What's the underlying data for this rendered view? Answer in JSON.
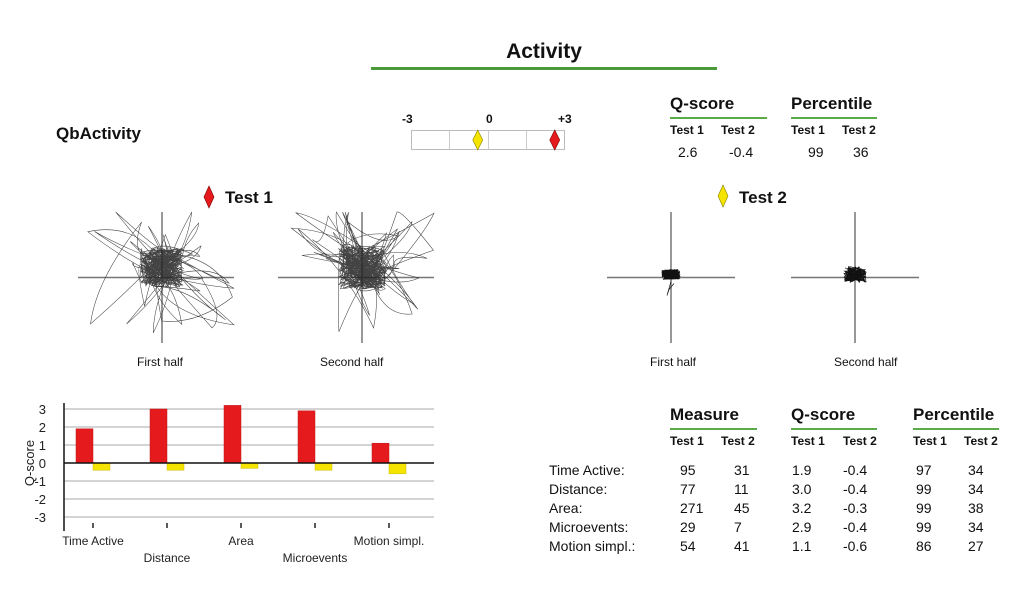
{
  "header": {
    "title": "Activity",
    "app_label": "QbActivity"
  },
  "scale": {
    "min_label": "-3",
    "mid_label": "0",
    "max_label": "+3",
    "range": [
      -3,
      3
    ],
    "test1_value": 2.6,
    "test2_value": -0.4
  },
  "summary": {
    "qscore": {
      "label": "Q-score",
      "test1_label": "Test 1",
      "test2_label": "Test 2",
      "test1": "2.6",
      "test2": "-0.4"
    },
    "percentile": {
      "label": "Percentile",
      "test1_label": "Test 1",
      "test2_label": "Test 2",
      "test1": "99",
      "test2": "36"
    }
  },
  "tests": [
    {
      "label": "Test 1",
      "color": "#e41a1c",
      "halves": [
        "First half",
        "Second half"
      ]
    },
    {
      "label": "Test 2",
      "color": "#f5e400",
      "halves": [
        "First half",
        "Second half"
      ]
    }
  ],
  "colors": {
    "test1": "#e41a1c",
    "test2": "#f5e400",
    "accent_rule": "#4a9a3a"
  },
  "table": {
    "groups": [
      {
        "label": "Measure",
        "sub": [
          "Test 1",
          "Test 2"
        ]
      },
      {
        "label": "Q-score",
        "sub": [
          "Test 1",
          "Test 2"
        ]
      },
      {
        "label": "Percentile",
        "sub": [
          "Test 1",
          "Test 2"
        ]
      }
    ],
    "rows": [
      {
        "label": "Time Active:",
        "m1": "95",
        "m2": "31",
        "q1": "1.9",
        "q2": "-0.4",
        "p1": "97",
        "p2": "34"
      },
      {
        "label": "Distance:",
        "m1": "77",
        "m2": "11",
        "q1": "3.0",
        "q2": "-0.4",
        "p1": "99",
        "p2": "34"
      },
      {
        "label": "Area:",
        "m1": "271",
        "m2": "45",
        "q1": "3.2",
        "q2": "-0.3",
        "p1": "99",
        "p2": "38"
      },
      {
        "label": "Microevents:",
        "m1": "29",
        "m2": "7",
        "q1": "2.9",
        "q2": "-0.4",
        "p1": "99",
        "p2": "34"
      },
      {
        "label": "Motion simpl.:",
        "m1": "54",
        "m2": "41",
        "q1": "1.1",
        "q2": "-0.6",
        "p1": "86",
        "p2": "27"
      }
    ]
  },
  "chart_data": {
    "type": "bar",
    "title": "",
    "xlabel": "",
    "ylabel": "Q-score",
    "ylim": [
      -3,
      3
    ],
    "yticks": [
      "3",
      "2",
      "1",
      "0",
      "-1",
      "-2",
      "-3"
    ],
    "grid": true,
    "categories": [
      "Time Active",
      "Distance",
      "Area",
      "Microevents",
      "Motion simpl."
    ],
    "series": [
      {
        "name": "Test 1",
        "color": "#e41a1c",
        "values": [
          1.9,
          3.0,
          3.2,
          2.9,
          1.1
        ]
      },
      {
        "name": "Test 2",
        "color": "#f5e400",
        "values": [
          -0.4,
          -0.4,
          -0.3,
          -0.4,
          -0.6
        ]
      }
    ]
  }
}
